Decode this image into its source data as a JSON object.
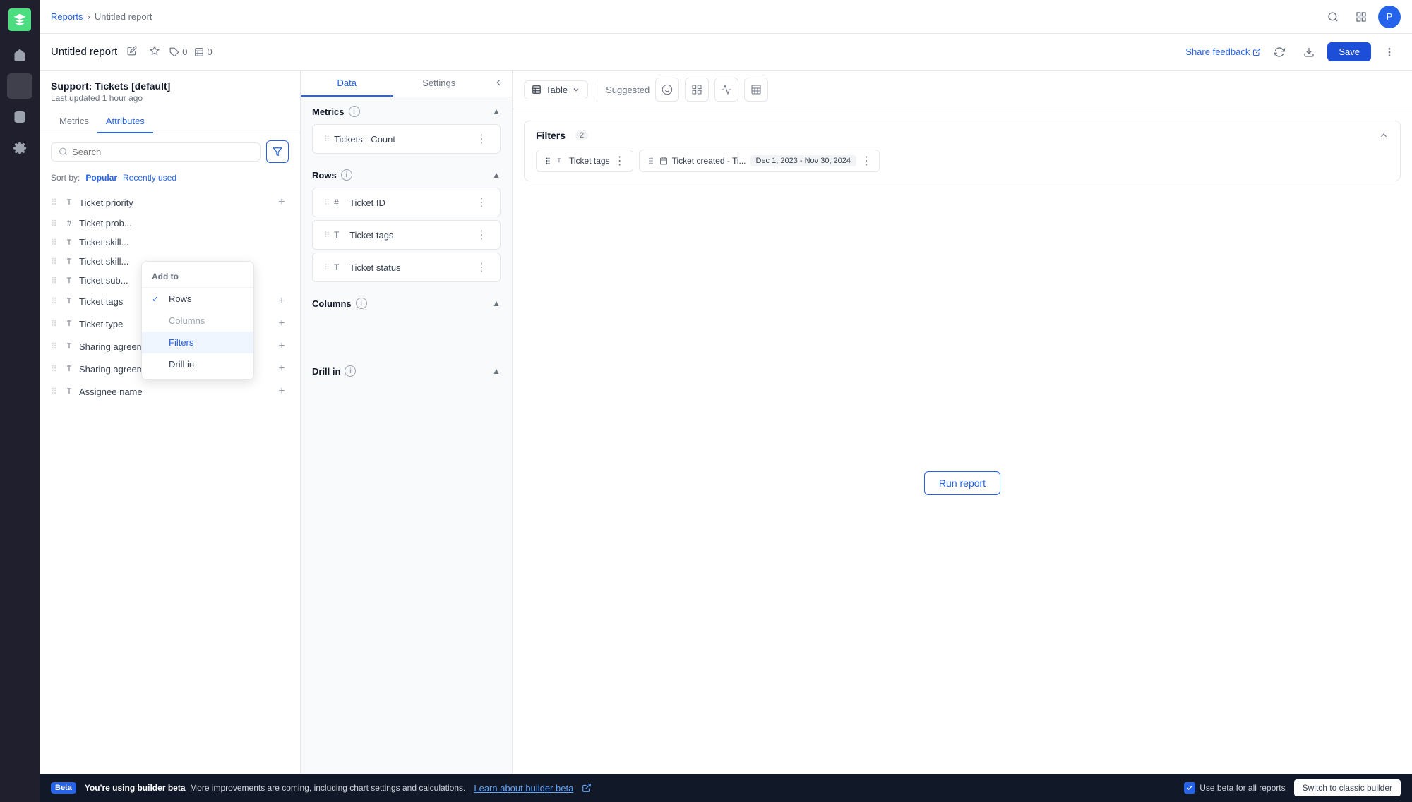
{
  "nav": {
    "logo_label": "Zendesk",
    "items": [
      {
        "name": "home",
        "icon": "grid"
      },
      {
        "name": "reporting",
        "icon": "chart",
        "active": true
      },
      {
        "name": "database",
        "icon": "database"
      },
      {
        "name": "settings",
        "icon": "gear"
      }
    ]
  },
  "topbar": {
    "breadcrumb_reports": "Reports",
    "breadcrumb_separator": ">",
    "breadcrumb_current": "Untitled report",
    "report_title": "Untitled report",
    "tag_count": "0",
    "table_count": "0",
    "share_feedback": "Share feedback",
    "save_label": "Save"
  },
  "left_panel": {
    "dataset_title": "Support: Tickets [default]",
    "last_updated": "Last updated 1 hour ago",
    "tab_metrics": "Metrics",
    "tab_attributes": "Attributes",
    "search_placeholder": "Search",
    "sort_label": "Sort by:",
    "sort_popular": "Popular",
    "sort_recent": "Recently used",
    "attributes": [
      {
        "type": "T",
        "label": "Ticket priority"
      },
      {
        "type": "#",
        "label": "Ticket prob..."
      },
      {
        "type": "T",
        "label": "Ticket skill..."
      },
      {
        "type": "T",
        "label": "Ticket skill..."
      },
      {
        "type": "T",
        "label": "Ticket sub..."
      },
      {
        "type": "T",
        "label": "Ticket tags"
      },
      {
        "type": "T",
        "label": "Ticket type"
      },
      {
        "type": "T",
        "label": "Sharing agreement inbo..."
      },
      {
        "type": "T",
        "label": "Sharing agreement outb..."
      },
      {
        "type": "T",
        "label": "Assignee name"
      }
    ]
  },
  "context_menu": {
    "header": "Add to",
    "items": [
      {
        "label": "Rows",
        "checked": true,
        "highlighted": false,
        "disabled": false
      },
      {
        "label": "Columns",
        "checked": false,
        "highlighted": false,
        "disabled": true
      },
      {
        "label": "Filters",
        "checked": false,
        "highlighted": true,
        "disabled": false
      },
      {
        "label": "Drill in",
        "checked": false,
        "highlighted": false,
        "disabled": false
      }
    ]
  },
  "middle_panel": {
    "tab_data": "Data",
    "tab_settings": "Settings",
    "metrics_title": "Metrics",
    "rows_title": "Rows",
    "columns_title": "Columns",
    "drill_in_title": "Drill in",
    "metric_item": "Tickets - Count",
    "row_items": [
      {
        "type": "#",
        "label": "Ticket ID"
      },
      {
        "type": "T",
        "label": "Ticket tags"
      },
      {
        "type": "T",
        "label": "Ticket status"
      }
    ]
  },
  "right_panel": {
    "viz_table": "Table",
    "suggested_label": "Suggested",
    "filters_title": "Filters",
    "filters_count": "2",
    "filter_tags": [
      {
        "label": "Ticket tags"
      },
      {
        "label": "Ticket created - Ti...",
        "date_range": "Dec 1, 2023 - Nov 30, 2024"
      }
    ],
    "run_report": "Run report"
  },
  "bottom_bar": {
    "beta_label": "Beta",
    "message": "You're using builder beta  More improvements are coming, including chart settings and calculations.",
    "link_text": "Learn about builder beta",
    "checkbox_label": "Use beta for all reports",
    "classic_btn": "Switch to classic builder"
  }
}
